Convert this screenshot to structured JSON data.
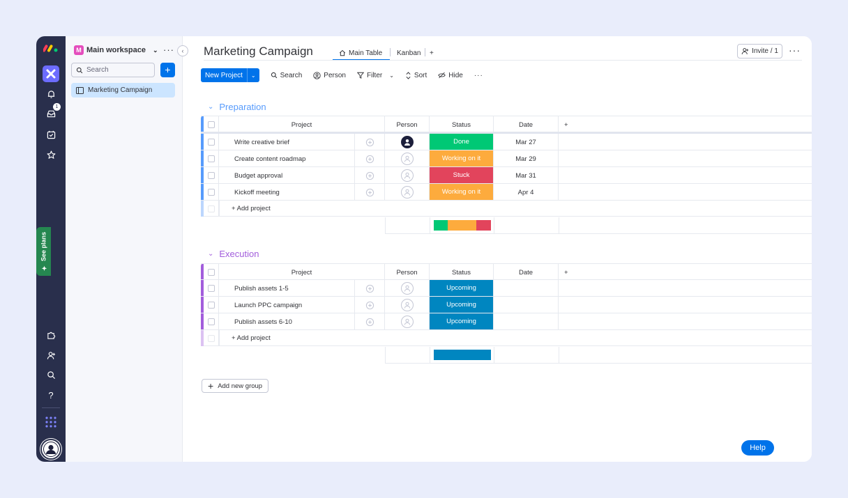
{
  "rail": {
    "notification_badge": "1",
    "see_plans_label": "See plans"
  },
  "sidebar": {
    "workspace_badge": "M",
    "workspace_name": "Main workspace",
    "search_placeholder": "Search",
    "add_label": "+",
    "items": [
      {
        "label": "Marketing Campaign"
      }
    ]
  },
  "header": {
    "board_title": "Marketing Campaign",
    "tabs": [
      {
        "label": "Main Table"
      },
      {
        "label": "Kanban"
      }
    ],
    "add_view_label": "+",
    "invite_label": "Invite / 1"
  },
  "toolbar": {
    "new_label": "New Project",
    "search_label": "Search",
    "person_label": "Person",
    "filter_label": "Filter",
    "sort_label": "Sort",
    "hide_label": "Hide"
  },
  "columns": {
    "project": "Project",
    "person": "Person",
    "status": "Status",
    "date": "Date"
  },
  "colors": {
    "done": "#00c875",
    "working": "#fdab3d",
    "stuck": "#e2445c",
    "upcoming": "#0086c0",
    "preparation": "#579bfc",
    "execution": "#a25ddc",
    "accent": "#0073ea"
  },
  "groups": [
    {
      "title": "Preparation",
      "add_label": "+ Add project",
      "rows": [
        {
          "name": "Write creative brief",
          "status": "Done",
          "date": "Mar 27"
        },
        {
          "name": "Create content roadmap",
          "status": "Working on it",
          "date": "Mar 29"
        },
        {
          "name": "Budget approval",
          "status": "Stuck",
          "date": "Mar 31"
        },
        {
          "name": "Kickoff meeting",
          "status": "Working on it",
          "date": "Apr 4"
        }
      ]
    },
    {
      "title": "Execution",
      "add_label": "+ Add project",
      "rows": [
        {
          "name": "Publish assets 1-5",
          "status": "Upcoming",
          "date": ""
        },
        {
          "name": "Launch PPC campaign",
          "status": "Upcoming",
          "date": ""
        },
        {
          "name": "Publish assets 6-10",
          "status": "Upcoming",
          "date": ""
        }
      ]
    }
  ],
  "add_group_label": "Add new group",
  "help_label": "Help"
}
